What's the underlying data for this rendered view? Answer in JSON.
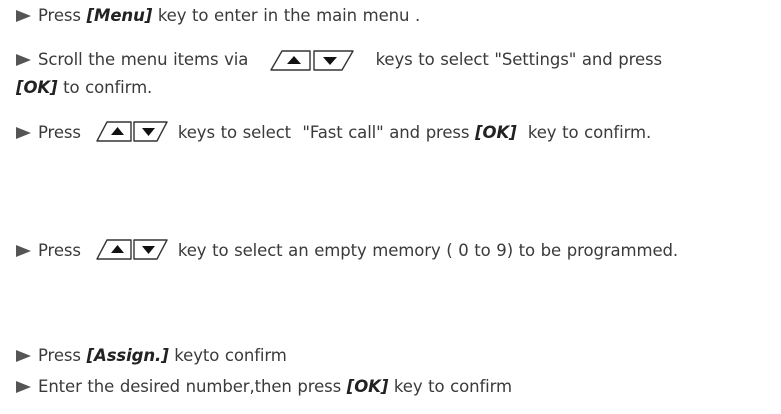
{
  "steps": [
    {
      "pre": "Press ",
      "key": "[Menu]",
      "post": " key to enter in the main menu ."
    },
    {
      "pre": "Scroll the menu items via ",
      "post_line1": " keys to select \"Settings\" and press",
      "key": "[OK]",
      "post_line2": " to confirm."
    },
    {
      "pre": "Press ",
      "mid": " keys to select  \"Fast call\" and press ",
      "key": "[OK]",
      "post": "  key to confirm."
    },
    {
      "pre": "Press ",
      "post": " key to select an empty memory ( 0 to 9) to be programmed."
    },
    {
      "pre": "Press ",
      "key": "[Assign.]",
      "post": " keyto confirm"
    },
    {
      "pre": "Enter the desired number,then press ",
      "key": "[OK]",
      "post": " key to confirm"
    }
  ],
  "icons": {
    "bullet": "arrow-bullet-icon",
    "nav_keys": "up-down-navigation-keys-icon"
  },
  "colors": {
    "text": "#3a3a3a",
    "bullet": "#555555",
    "key_outline": "#333333"
  }
}
